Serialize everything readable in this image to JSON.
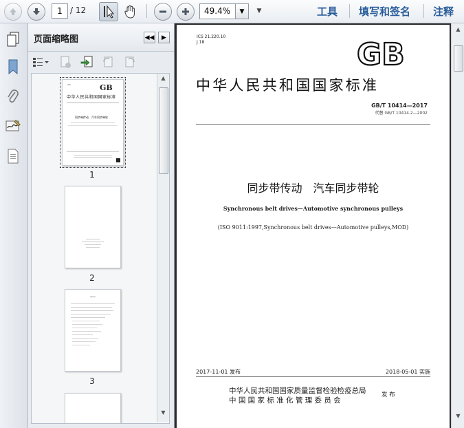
{
  "toolbar": {
    "page_current": "1",
    "page_total": "/ 12",
    "zoom": "49.4%",
    "tools_label": "工具",
    "sign_label": "填写和签名",
    "comment_label": "注释"
  },
  "panel": {
    "title": "页面缩略图",
    "thumbnails": [
      {
        "page": "1"
      },
      {
        "page": "2"
      },
      {
        "page": "3"
      }
    ]
  },
  "document": {
    "ics": "ICS 21.220.10",
    "ccs": "J 18",
    "logo": "GB",
    "standard_title": "中华人民共和国国家标准",
    "code": "GB/T 10414—2017",
    "replaces": "代替 GB/T 10414.2—2002",
    "title_cn": "同步带传动　汽车同步带轮",
    "title_en": "Synchronous belt drives—Automotive synchronous pulleys",
    "iso_ref": "(ISO 9011:1997,Synchronous belt drives—Automotive pulleys,MOD)",
    "publish_date": "2017-11-01 发布",
    "effective_date": "2018-05-01 实施",
    "issuer_1": "中华人民共和国国家质量监督检验检疫总局",
    "issuer_2": "中 国 国 家 标 准 化 管 理 委 员 会",
    "issue_word": "发 布"
  }
}
